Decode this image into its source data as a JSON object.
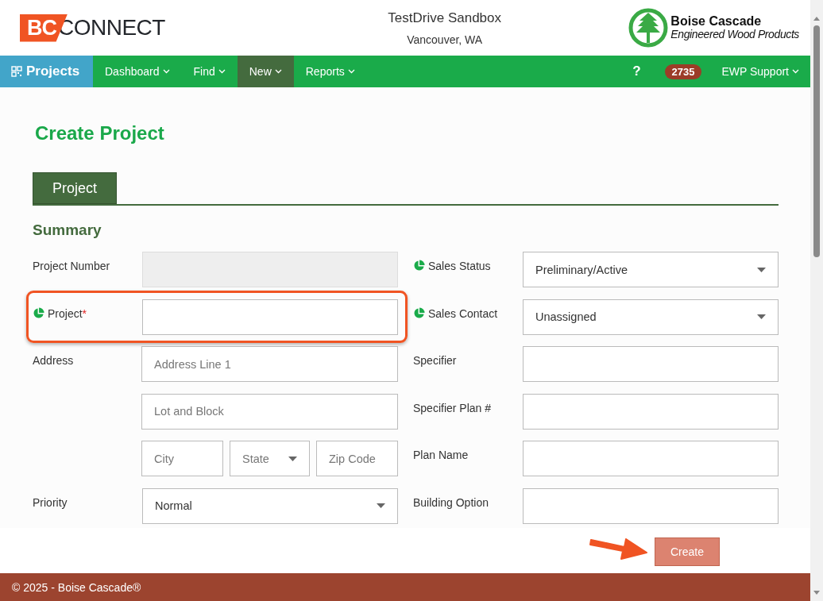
{
  "header": {
    "logo": {
      "mark": "BC",
      "word": "CONNECT"
    },
    "title": "TestDrive Sandbox",
    "subtitle": "Vancouver, WA",
    "brand": {
      "name": "Boise Cascade",
      "tagline": "Engineered Wood Products"
    }
  },
  "nav": {
    "items": [
      {
        "label": "Projects",
        "kind": "home",
        "selected": false
      },
      {
        "label": "Dashboard",
        "kind": "menu",
        "selected": false
      },
      {
        "label": "Find",
        "kind": "menu",
        "selected": false
      },
      {
        "label": "New",
        "kind": "menu",
        "selected": true
      },
      {
        "label": "Reports",
        "kind": "menu",
        "selected": false
      }
    ],
    "help": "?",
    "badge": "2735",
    "user": "EWP Support"
  },
  "page_title": "Create Project",
  "tabs": [
    {
      "label": "Project",
      "selected": true
    }
  ],
  "section": "Summary",
  "left_fields": [
    {
      "label": "Project Number",
      "flagged": false,
      "highlighted": false,
      "lines": [
        [
          {
            "kind": "readonly"
          }
        ]
      ]
    },
    {
      "label": "Project",
      "required_mark": "*",
      "flagged": true,
      "highlighted": true,
      "lines": [
        [
          {
            "kind": "text"
          }
        ]
      ]
    },
    {
      "label": "Address",
      "flagged": false,
      "highlighted": false,
      "lines": [
        [
          {
            "kind": "text",
            "placeholder": "Address Line 1"
          }
        ],
        [
          {
            "kind": "text",
            "placeholder": "Lot and Block"
          }
        ],
        [
          {
            "kind": "text",
            "placeholder": "City"
          },
          {
            "kind": "select",
            "placeholder": "State"
          },
          {
            "kind": "text",
            "placeholder": "Zip Code"
          }
        ]
      ]
    },
    {
      "label": "Priority",
      "flagged": false,
      "highlighted": false,
      "lines": [
        [
          {
            "kind": "select",
            "value": "Normal"
          }
        ]
      ]
    }
  ],
  "right_fields": [
    {
      "label": "Sales Status",
      "flagged": true,
      "highlighted": false,
      "lines": [
        [
          {
            "kind": "select",
            "value": "Preliminary/Active"
          }
        ]
      ]
    },
    {
      "label": "Sales Contact",
      "flagged": true,
      "highlighted": false,
      "lines": [
        [
          {
            "kind": "select",
            "value": "Unassigned"
          }
        ]
      ]
    },
    {
      "label": "Specifier",
      "flagged": false,
      "highlighted": false,
      "lines": [
        [
          {
            "kind": "text"
          }
        ]
      ]
    },
    {
      "label": "Specifier Plan #",
      "flagged": false,
      "highlighted": false,
      "lines": [
        [
          {
            "kind": "text"
          }
        ]
      ]
    },
    {
      "label": "Plan Name",
      "flagged": false,
      "highlighted": false,
      "lines": [
        [
          {
            "kind": "text"
          }
        ]
      ]
    },
    {
      "label": "Building Option",
      "flagged": false,
      "highlighted": false,
      "lines": [
        [
          {
            "kind": "text"
          }
        ]
      ]
    }
  ],
  "create_button": {
    "label": "Create",
    "disabled": true,
    "pointed": true
  },
  "footer": "© 2025 - Boise Cascade®"
}
